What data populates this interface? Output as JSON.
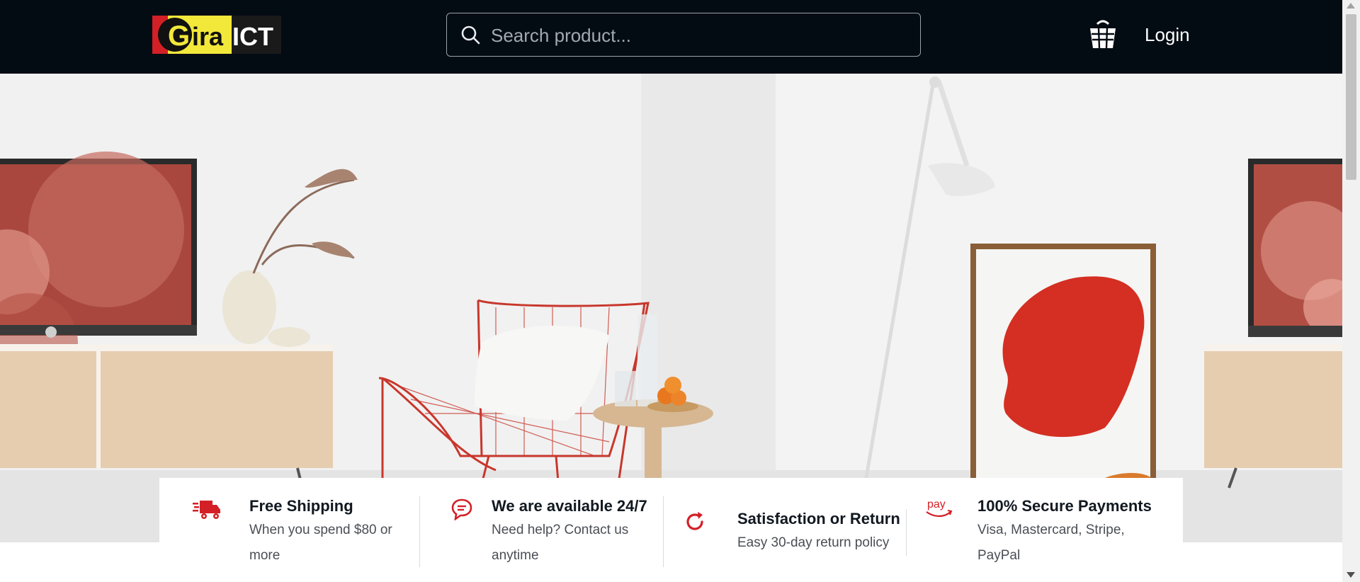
{
  "header": {
    "logo_text_left": "Gira",
    "logo_text_right": "ICT",
    "search": {
      "placeholder": "Search product...",
      "icon": "search-icon"
    },
    "cart_icon": "basket-icon",
    "login_label": "Login"
  },
  "colors": {
    "header_bg": "#030b13",
    "accent_red": "#d32027",
    "logo_yellow": "#f2e83a"
  },
  "features": [
    {
      "icon": "delivery-truck-icon",
      "title": "Free Shipping",
      "desc": "When you spend $80 or more"
    },
    {
      "icon": "chat-bubble-icon",
      "title": "We are available 24/7",
      "desc": "Need help? Contact us anytime"
    },
    {
      "icon": "refresh-icon",
      "title": "Satisfaction or Return",
      "desc": "Easy 30-day return policy"
    },
    {
      "icon": "amazon-pay-icon",
      "icon_label": "pay",
      "title": "100% Secure Payments",
      "desc": "Visa, Mastercard, Stripe, PayPal"
    }
  ]
}
